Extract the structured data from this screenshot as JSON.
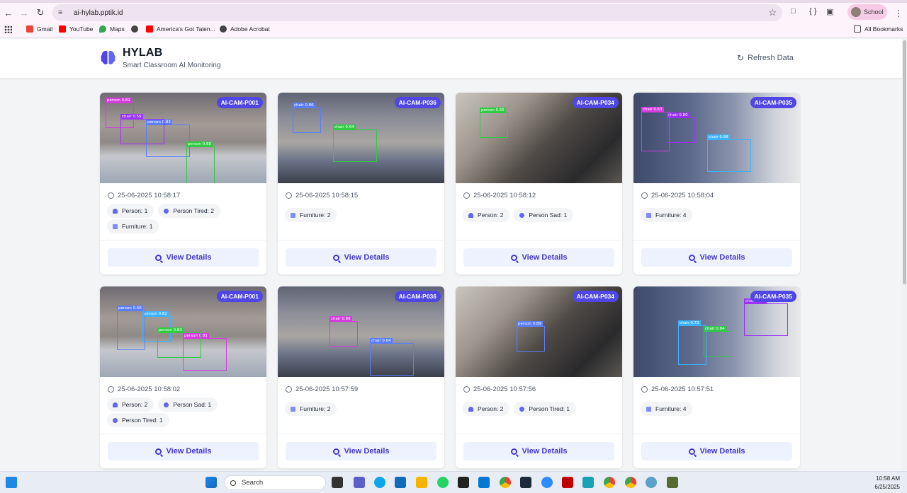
{
  "browser": {
    "url": "ai-hylab.pptik.id",
    "profile_label": "School",
    "bookmarks": [
      "Gmail",
      "YouTube",
      "Maps",
      "America's Got Talen...",
      "Adobe Acrobat"
    ],
    "all_bookmarks": "All Bookmarks"
  },
  "header": {
    "title": "HYLAB",
    "subtitle": "Smart Classroom AI Monitoring",
    "refresh_label": "Refresh Data"
  },
  "cards": [
    {
      "camera": "AI-CAM-P001",
      "timestamp": "25-06-2025 10:58:17",
      "scene": "room",
      "tags": [
        {
          "icon": "person",
          "label": "Person: 1"
        },
        {
          "icon": "face",
          "label": "Person Tired: 2"
        },
        {
          "icon": "chair",
          "label": "Furniture: 1"
        }
      ],
      "detections": [
        "person 0.82",
        "person 0.83",
        "person 0.88",
        "chair 0.59"
      ]
    },
    {
      "camera": "AI-CAM-P036",
      "timestamp": "25-06-2025 10:58:15",
      "scene": "shelf",
      "tags": [
        {
          "icon": "chair",
          "label": "Furniture: 2"
        }
      ],
      "detections": [
        "chair 0.86",
        "chair 0.64"
      ]
    },
    {
      "camera": "AI-CAM-P034",
      "timestamp": "25-06-2025 10:58:12",
      "scene": "close",
      "tags": [
        {
          "icon": "person",
          "label": "Person: 2"
        },
        {
          "icon": "face",
          "label": "Person Sad: 1"
        }
      ],
      "detections": [
        "person 0.65"
      ]
    },
    {
      "camera": "AI-CAM-P035",
      "timestamp": "25-06-2025 10:58:04",
      "scene": "cab",
      "tags": [
        {
          "icon": "chair",
          "label": "Furniture: 4"
        }
      ],
      "detections": [
        "chair 0.80",
        "chair 0.88",
        "chair 0.63"
      ]
    },
    {
      "camera": "AI-CAM-P001",
      "timestamp": "25-06-2025 10:58:02",
      "scene": "room",
      "tags": [
        {
          "icon": "person",
          "label": "Person: 2"
        },
        {
          "icon": "face",
          "label": "Person Sad: 1"
        },
        {
          "icon": "face",
          "label": "Person Tired: 1"
        }
      ],
      "detections": [
        "person 0.82",
        "person 0.81",
        "person 0.56",
        "person 0.83"
      ]
    },
    {
      "camera": "AI-CAM-P036",
      "timestamp": "25-06-2025 10:57:59",
      "scene": "shelf",
      "tags": [
        {
          "icon": "chair",
          "label": "Furniture: 2"
        }
      ],
      "detections": [
        "chair 0.86",
        "chair 0.64"
      ]
    },
    {
      "camera": "AI-CAM-P034",
      "timestamp": "25-06-2025 10:57:56",
      "scene": "close",
      "tags": [
        {
          "icon": "person",
          "label": "Person: 2"
        },
        {
          "icon": "face",
          "label": "Person Tired: 1"
        }
      ],
      "detections": [
        "person 0.89"
      ]
    },
    {
      "camera": "AI-CAM-P035",
      "timestamp": "25-06-2025 10:57:51",
      "scene": "cab",
      "tags": [
        {
          "icon": "chair",
          "label": "Furniture: 4"
        }
      ],
      "detections": [
        "chair 0.84",
        "chair 0.87",
        "chair 0.72"
      ]
    }
  ],
  "view_details_label": "View Details",
  "taskbar": {
    "search_label": "Search",
    "time": "10:58 AM",
    "date": "6/25/2025"
  },
  "colors": {
    "accent": "#4f46e5",
    "button_bg": "#eef2ff",
    "button_text": "#4338ca"
  }
}
